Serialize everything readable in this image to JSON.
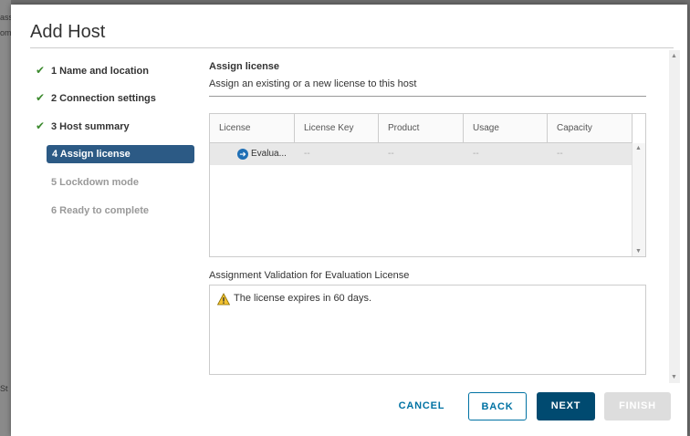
{
  "background": {
    "fragments": [
      "ass",
      "om",
      "St"
    ]
  },
  "dialog": {
    "title": "Add Host",
    "steps": [
      {
        "label": "1 Name and location",
        "state": "complete"
      },
      {
        "label": "2 Connection settings",
        "state": "complete"
      },
      {
        "label": "3 Host summary",
        "state": "complete"
      },
      {
        "label": "4 Assign license",
        "state": "active"
      },
      {
        "label": "5 Lockdown mode",
        "state": "disabled"
      },
      {
        "label": "6 Ready to complete",
        "state": "disabled"
      }
    ],
    "section": {
      "title": "Assign license",
      "subtitle": "Assign an existing or a new license to this host"
    },
    "grid": {
      "columns": [
        "License",
        "License Key",
        "Product",
        "Usage",
        "Capacity"
      ],
      "rows": [
        {
          "license": "Evalua...",
          "license_key": "--",
          "product": "--",
          "usage": "--",
          "capacity": "--"
        }
      ]
    },
    "validation": {
      "label": "Assignment Validation for Evaluation License",
      "message": "The license expires in 60 days."
    },
    "buttons": {
      "cancel": "CANCEL",
      "back": "BACK",
      "next": "NEXT",
      "finish": "FINISH"
    },
    "colors": {
      "active_step": "#2c5a85",
      "primary": "#004a70",
      "link": "#0072a3",
      "check": "#3c8a2e"
    }
  }
}
